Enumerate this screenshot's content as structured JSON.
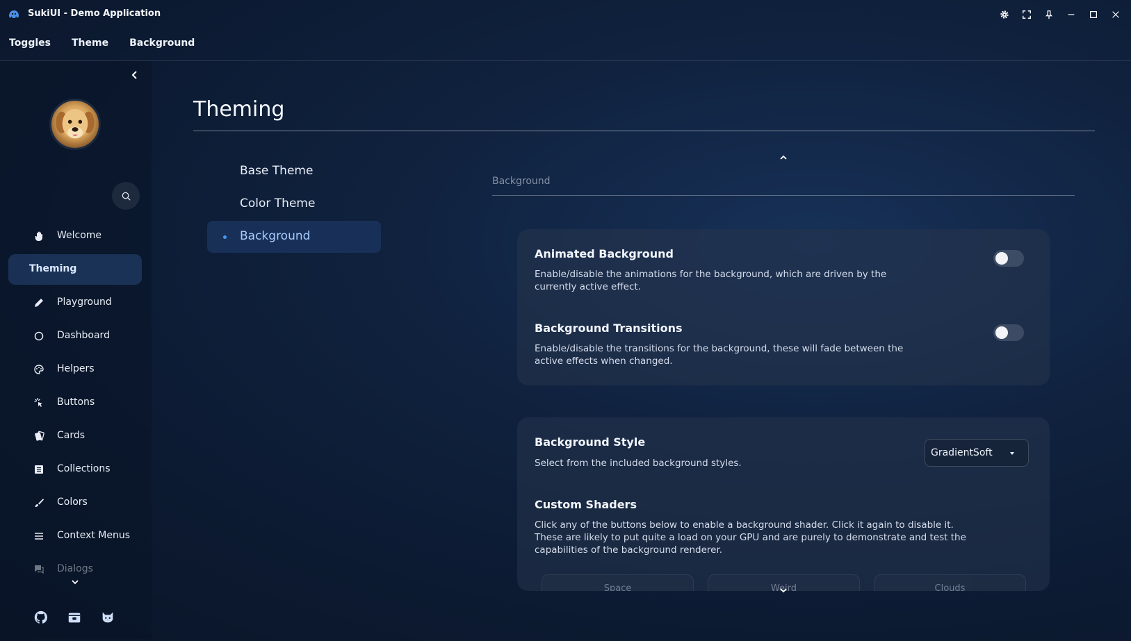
{
  "window": {
    "title": "SukiUI - Demo Application",
    "controls": [
      "gear-icon",
      "fullscreen-icon",
      "pin-icon",
      "minimize-icon",
      "maximize-icon",
      "close-icon"
    ]
  },
  "menu": {
    "items": [
      "Toggles",
      "Theme",
      "Background"
    ]
  },
  "sidebar": {
    "items": [
      {
        "label": "Welcome",
        "icon": "hand-icon"
      },
      {
        "label": "Theming",
        "icon": "",
        "active": true
      },
      {
        "label": "Playground",
        "icon": "pencil-icon"
      },
      {
        "label": "Dashboard",
        "icon": "circle-icon"
      },
      {
        "label": "Helpers",
        "icon": "palette-icon"
      },
      {
        "label": "Buttons",
        "icon": "click-icon"
      },
      {
        "label": "Cards",
        "icon": "cards-icon"
      },
      {
        "label": "Collections",
        "icon": "list-icon"
      },
      {
        "label": "Colors",
        "icon": "brush-icon"
      },
      {
        "label": "Context Menus",
        "icon": "menu-icon"
      },
      {
        "label": "Dialogs",
        "icon": "chat-icon"
      }
    ],
    "footer_icons": [
      "github-icon",
      "store-icon",
      "cat-icon"
    ]
  },
  "page": {
    "title": "Theming",
    "subnav": [
      {
        "label": "Base Theme"
      },
      {
        "label": "Color Theme"
      },
      {
        "label": "Background",
        "active": true
      }
    ],
    "section_label": "Background"
  },
  "settings": {
    "animated": {
      "title": "Animated Background",
      "desc": "Enable/disable the animations for the background, which are driven by the currently active effect.",
      "enabled": false
    },
    "transitions": {
      "title": "Background Transitions",
      "desc": "Enable/disable the transitions for the background, these will fade between the active effects when changed.",
      "enabled": false
    },
    "style": {
      "title": "Background Style",
      "desc": "Select from the included background styles.",
      "selected": "GradientSoft"
    },
    "shaders": {
      "title": "Custom Shaders",
      "desc": "Click any of the buttons below to enable a background shader. Click it again to disable it. These are likely to put quite a load on your GPU and are purely to demonstrate and test the capabilities of the background renderer.",
      "buttons": [
        "Space",
        "Weird",
        "Clouds"
      ]
    }
  },
  "colors": {
    "accent": "#4f95f0",
    "active_nav": "#284878"
  }
}
